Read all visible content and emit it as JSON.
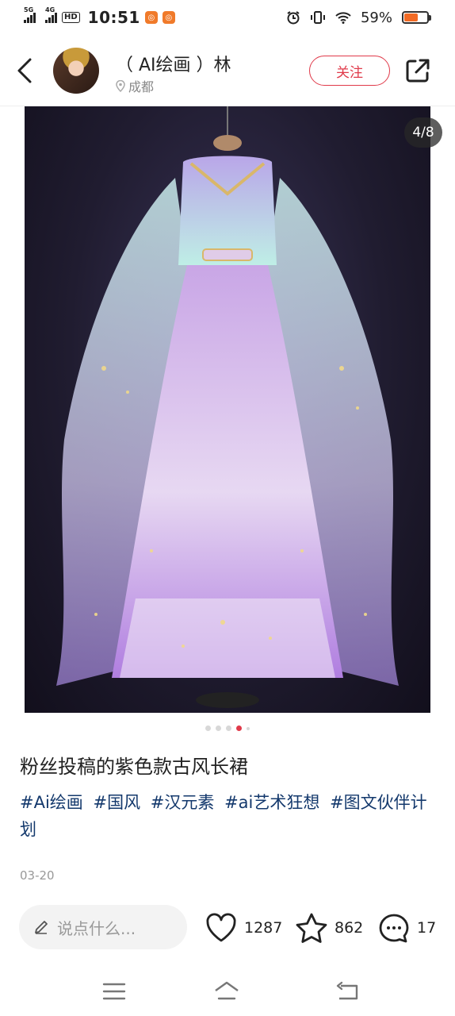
{
  "status_bar": {
    "net1": "5G",
    "net2": "4G",
    "hd": "HD",
    "time": "10:51",
    "battery_percent": "59%",
    "battery_level": 0.59
  },
  "header": {
    "username": "（ AI绘画 ）林",
    "location": "成都",
    "follow_label": "关注"
  },
  "gallery": {
    "counter": "4/8",
    "current_index": 4,
    "total": 8
  },
  "post": {
    "title": "粉丝投稿的紫色款古风长裙",
    "tags": [
      "#Ai绘画",
      "#国风",
      "#汉元素",
      "#ai艺术狂想",
      "#图文伙伴计划"
    ],
    "date": "03-20"
  },
  "bottom_bar": {
    "comment_placeholder": "说点什么...",
    "likes": "1287",
    "favorites": "862",
    "comments": "17"
  },
  "colors": {
    "accent": "#e03a4a",
    "tag_link": "#13386c",
    "battery": "#f26a24"
  }
}
